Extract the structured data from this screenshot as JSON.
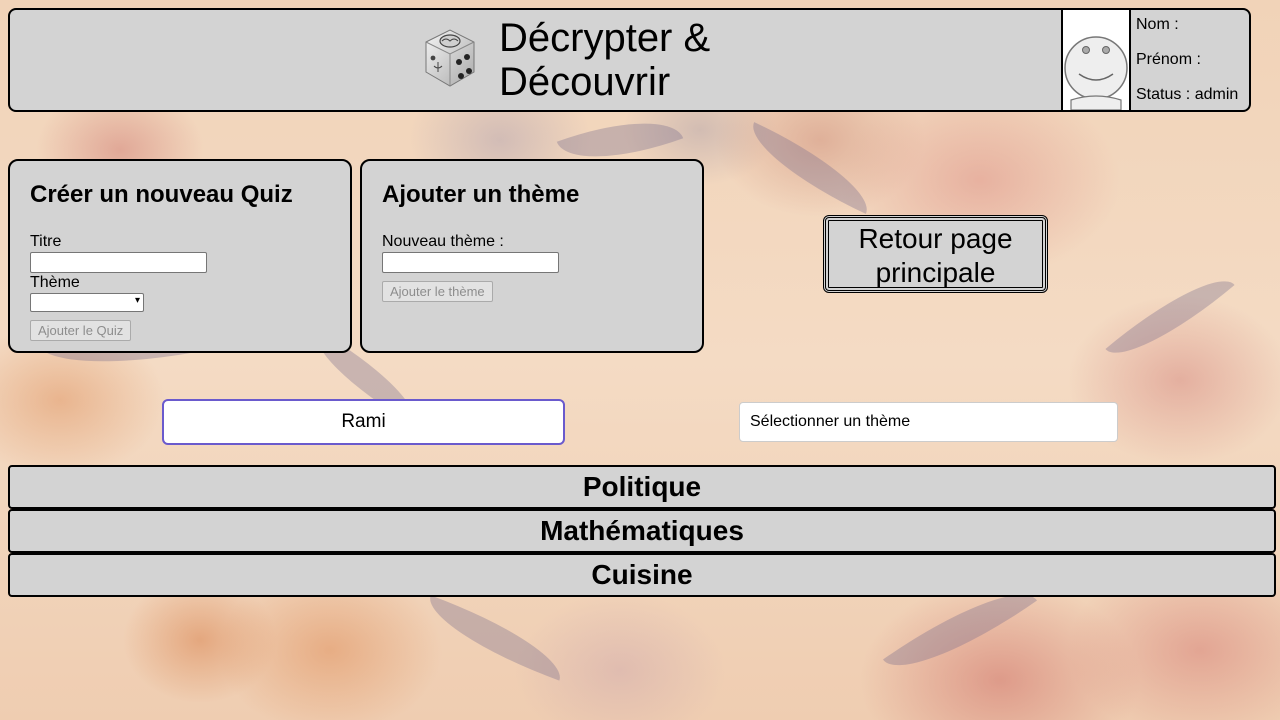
{
  "header": {
    "title": "Décrypter & Découvrir",
    "user": {
      "nom_label": "Nom :",
      "prenom_label": "Prénom :",
      "status_label": "Status : admin"
    }
  },
  "create_quiz": {
    "heading": "Créer un nouveau Quiz",
    "title_label": "Titre",
    "title_value": "",
    "theme_label": "Thème",
    "theme_selected": "",
    "submit_label": "Ajouter le Quiz"
  },
  "add_theme": {
    "heading": "Ajouter un thème",
    "new_theme_label": "Nouveau thème :",
    "new_theme_value": "",
    "submit_label": "Ajouter le thème"
  },
  "back_button": {
    "label": "Retour page principale"
  },
  "search": {
    "value": "Rami"
  },
  "theme_filter": {
    "selected": "Sélectionner un thème"
  },
  "themes": [
    {
      "label": "Politique"
    },
    {
      "label": "Mathématiques"
    },
    {
      "label": "Cuisine"
    }
  ],
  "colors": {
    "panel_bg": "#d3d3d3",
    "search_border": "#6a5acd",
    "page_bg": "#f3d6bd"
  }
}
